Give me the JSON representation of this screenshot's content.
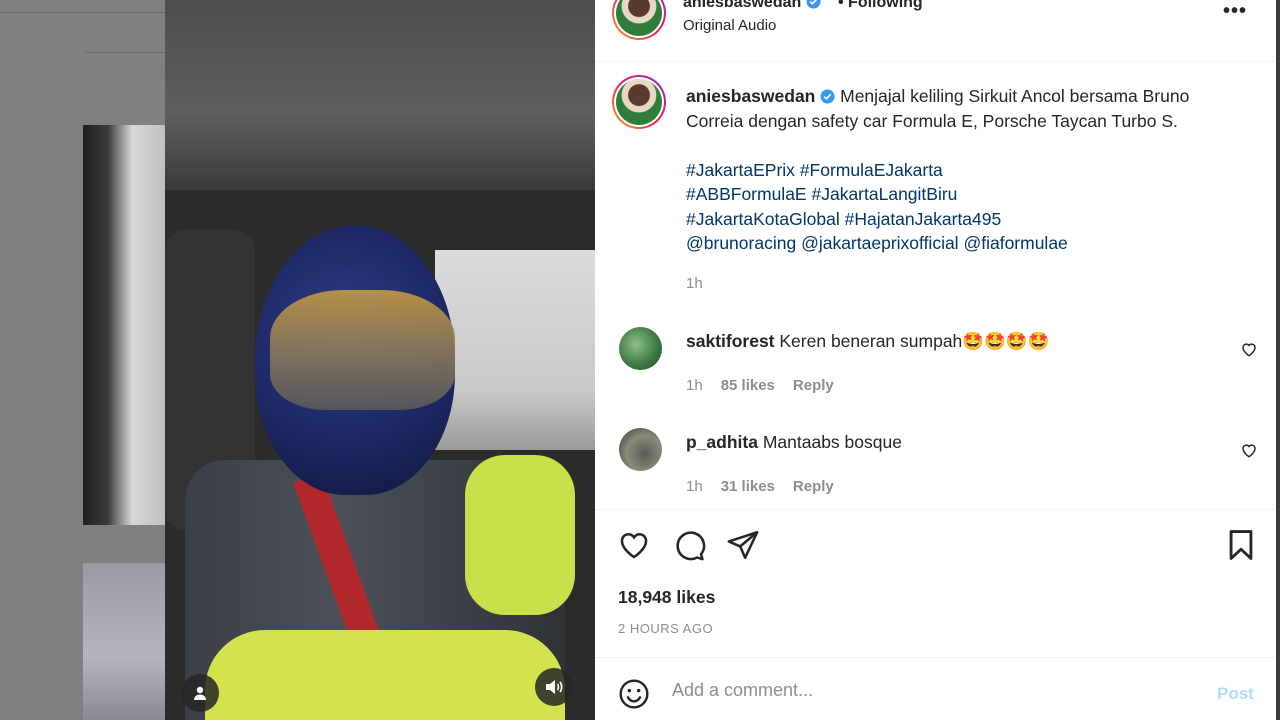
{
  "post": {
    "username": "aniesbaswedan",
    "following_label": "• Following",
    "audio_label": "Original Audio",
    "more_label": "•••",
    "caption_text": " Menjajal keliling Sirkuit Ancol bersama Bruno Correia dengan safety car Formula E, Porsche Taycan Turbo S.",
    "hashtags_line1": [
      "#JakartaEPrix",
      "#FormulaEJakarta"
    ],
    "hashtags_line2": [
      "#ABBFormulaE",
      "#JakartaLangitBiru"
    ],
    "hashtags_line3": [
      "#JakartaKotaGlobal",
      "#HajatanJakarta495"
    ],
    "mentions": [
      "@brunoracing",
      "@jakartaeprixofficial",
      "@fiaformulae"
    ],
    "time": "1h",
    "likes": "18,948 likes",
    "posted_ago": "2 HOURS AGO"
  },
  "comments": [
    {
      "username": "saktiforest",
      "text": " Keren beneran sumpah🤩🤩🤩🤩",
      "time": "1h",
      "likes": "85 likes",
      "reply": "Reply"
    },
    {
      "username": "p_adhita",
      "text": " Mantaabs bosque",
      "time": "1h",
      "likes": "31 likes",
      "reply": "Reply"
    }
  ],
  "composer": {
    "placeholder": "Add a comment...",
    "post_label": "Post"
  },
  "colors": {
    "link": "#00376b",
    "muted": "#8e8e8e",
    "verified": "#3897f0",
    "post_disabled": "#b3dbff"
  },
  "icons": {
    "like": "heart-icon",
    "comment": "comment-icon",
    "share": "send-icon",
    "save": "bookmark-icon",
    "emoji": "emoji-icon",
    "video_user": "user-icon",
    "video_sound": "speaker-icon"
  }
}
